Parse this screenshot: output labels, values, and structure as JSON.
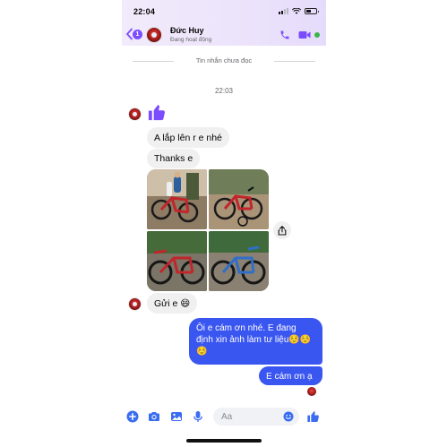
{
  "status_bar": {
    "time": "22:04"
  },
  "header": {
    "back_badge_count": "1",
    "contact_name": "Đức Huy",
    "contact_status": "Đang hoạt động",
    "accent_color": "#7b4dff"
  },
  "thread": {
    "unread_separator": "Tin nhắn chưa đọc",
    "timestamp": "22:03",
    "messages": [
      {
        "from": "contact",
        "kind": "sticker",
        "icon": "thumbs-up-icon"
      },
      {
        "from": "contact",
        "kind": "text",
        "text": "A lắp lên r e nhé"
      },
      {
        "from": "contact",
        "kind": "text",
        "text": "Thanks e"
      },
      {
        "from": "contact",
        "kind": "photos",
        "count": 4,
        "description_icons": [
          "bicycle-photo",
          "bicycle-photo",
          "bicycle-photo",
          "bicycle-photo"
        ]
      },
      {
        "from": "contact",
        "kind": "text",
        "text": "Gửi e 😄"
      },
      {
        "from": "me",
        "kind": "text",
        "text": "Ôi e cám ơn nhé. E đang định xin ảnh làm tư liệu☺️☺️☺️"
      },
      {
        "from": "me",
        "kind": "text",
        "text": "E cám ơn ạ"
      }
    ]
  },
  "composer": {
    "placeholder": "Aa"
  },
  "colors": {
    "outgoing_bubble": "#3a56f0",
    "incoming_bubble": "#f0f0f0",
    "icon_blue": "#3a6df0",
    "online": "#3bb44a"
  }
}
